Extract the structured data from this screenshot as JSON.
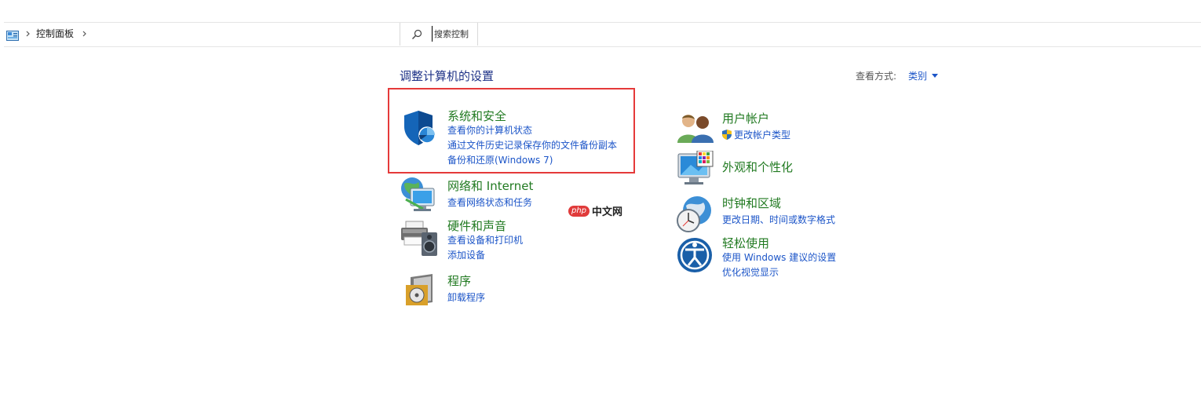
{
  "address_bar": {
    "breadcrumb": "控制面板",
    "search_placeholder": "搜索控制"
  },
  "header": {
    "title": "调整计算机的设置",
    "view_by_label": "查看方式:",
    "view_by_value": "类别"
  },
  "left_column": [
    {
      "title": "系统和安全",
      "links": [
        "查看你的计算机状态",
        "通过文件历史记录保存你的文件备份副本",
        "备份和还原(Windows 7)"
      ]
    },
    {
      "title": "网络和 Internet",
      "links": [
        "查看网络状态和任务"
      ]
    },
    {
      "title": "硬件和声音",
      "links": [
        "查看设备和打印机",
        "添加设备"
      ]
    },
    {
      "title": "程序",
      "links": [
        "卸载程序"
      ]
    }
  ],
  "right_column": [
    {
      "title": "用户帐户",
      "links": [
        "更改帐户类型"
      ]
    },
    {
      "title": "外观和个性化",
      "links": []
    },
    {
      "title": "时钟和区域",
      "links": [
        "更改日期、时间或数字格式"
      ]
    },
    {
      "title": "轻松使用",
      "links": [
        "使用 Windows 建议的设置",
        "优化视觉显示"
      ]
    }
  ],
  "watermark": {
    "badge": "php",
    "text": "中文网"
  },
  "colors": {
    "title_green": "#217a21",
    "link_blue": "#1c55c8",
    "heading_blue": "#1e3287",
    "highlight_red": "#e53a3a"
  }
}
